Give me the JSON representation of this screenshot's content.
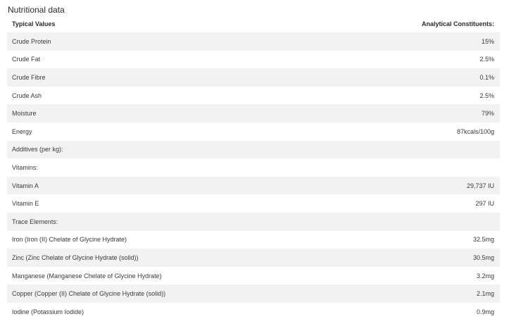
{
  "title": "Nutritional data",
  "header": {
    "left": "Typical Values",
    "right": "Analytical Constituents:"
  },
  "rows": [
    {
      "label": "Crude Protein",
      "value": "15%"
    },
    {
      "label": "Crude Fat",
      "value": "2.5%"
    },
    {
      "label": "Crude Fibre",
      "value": "0.1%"
    },
    {
      "label": "Crude Ash",
      "value": "2.5%"
    },
    {
      "label": "Moisture",
      "value": "79%"
    },
    {
      "label": "Energy",
      "value": "87kcals/100g"
    },
    {
      "label": "Additives (per kg):",
      "value": ""
    },
    {
      "label": "Vitamins:",
      "value": ""
    },
    {
      "label": "Vitamin A",
      "value": "29,737 IU"
    },
    {
      "label": "Vitamin E",
      "value": "297 IU"
    },
    {
      "label": "Trace Elements:",
      "value": ""
    },
    {
      "label": "Iron (Iron (II) Chelate of Glycine Hydrate)",
      "value": "32.5mg"
    },
    {
      "label": "Zinc (Zinc Chelate of Glycine Hydrate (solid))",
      "value": "30.5mg"
    },
    {
      "label": "Manganese (Manganese Chelate of Glycine Hydrate)",
      "value": "3.2mg"
    },
    {
      "label": "Copper (Copper (II) Chelate of Glycine Hydrate (solid))",
      "value": "2.1mg"
    },
    {
      "label": "Iodine (Potassium Iodide)",
      "value": "0.9mg"
    }
  ]
}
